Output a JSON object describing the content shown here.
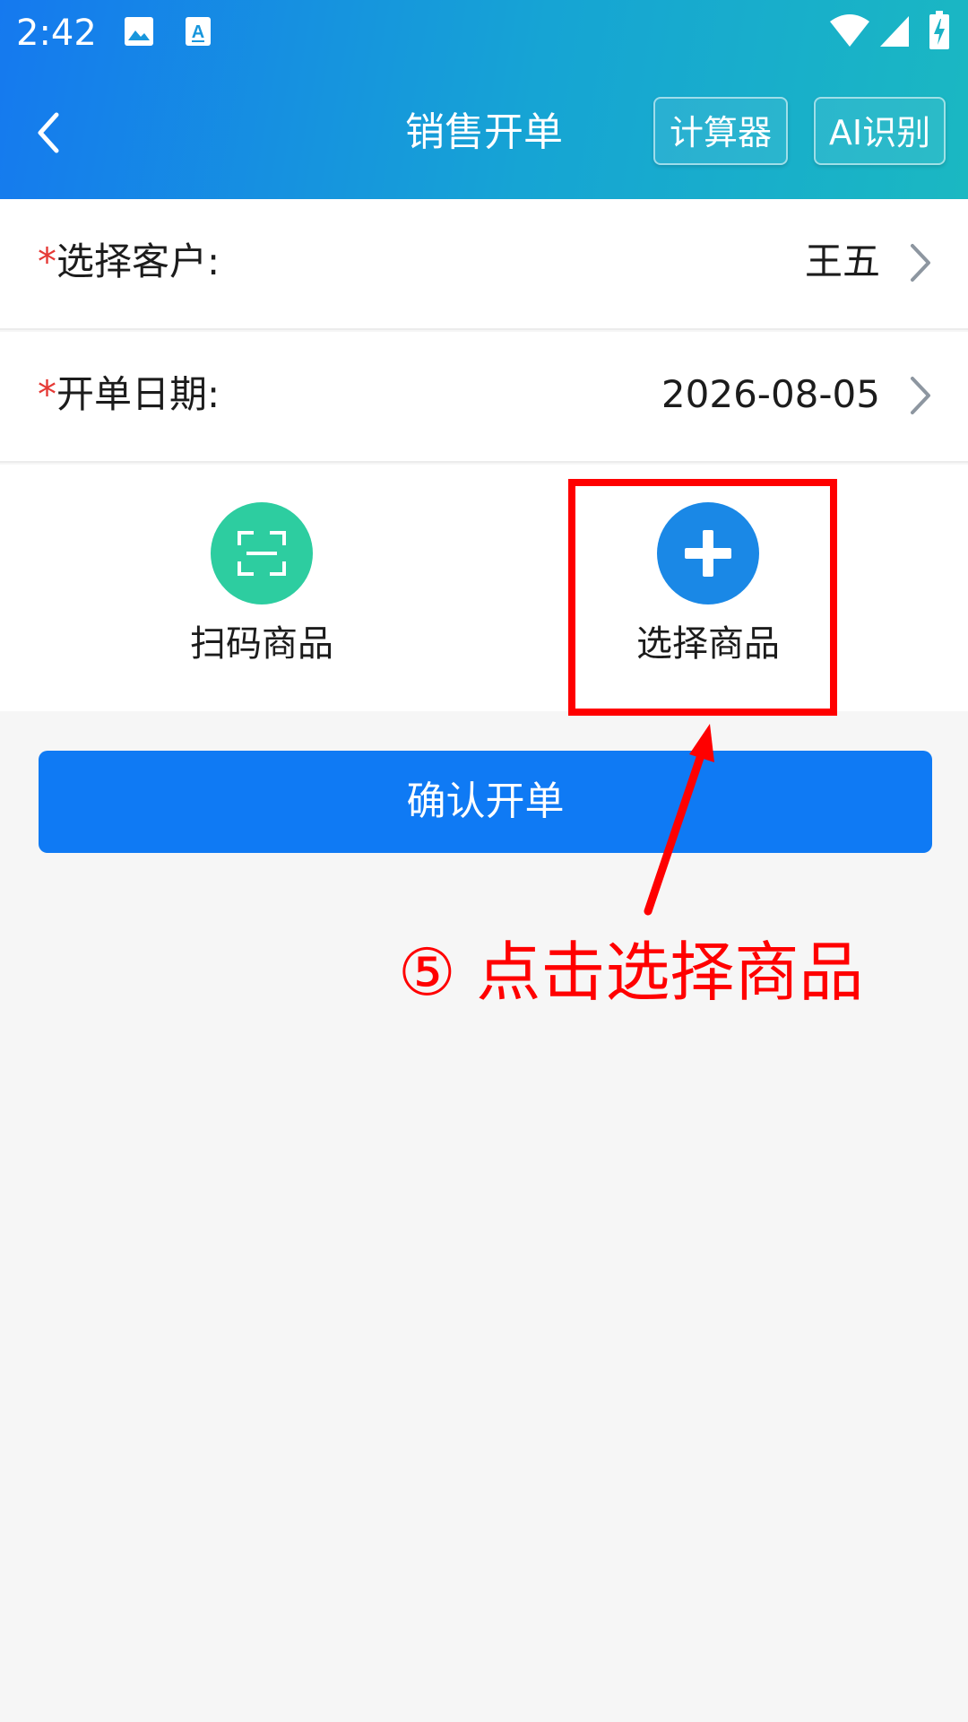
{
  "status_bar": {
    "time": "2:42",
    "icons": [
      "image-icon",
      "font-download-icon",
      "wifi-icon",
      "cellular-signal-icon",
      "battery-charging-icon"
    ]
  },
  "header": {
    "title": "销售开单",
    "back_icon": "chevron-left-icon",
    "calculator_label": "计算器",
    "ai_label": "AI识别"
  },
  "form": {
    "customer": {
      "required_mark": "*",
      "label": "选择客户:",
      "value": "王五"
    },
    "date": {
      "required_mark": "*",
      "label": "开单日期:",
      "value": "2026-08-05"
    }
  },
  "actions": {
    "scan": {
      "label": "扫码商品",
      "icon": "scan-frame-icon",
      "color": "#2dcda0"
    },
    "select": {
      "label": "选择商品",
      "icon": "plus-icon",
      "color": "#1a88e6"
    }
  },
  "confirm_label": "确认开单",
  "annotation": {
    "text": "⑤ 点击选择商品",
    "color": "#ff0000"
  },
  "colors": {
    "header_gradient_start": "#1579ef",
    "header_gradient_end": "#1ab8c2",
    "primary_button": "#0f7af4",
    "required": "#e53935"
  }
}
